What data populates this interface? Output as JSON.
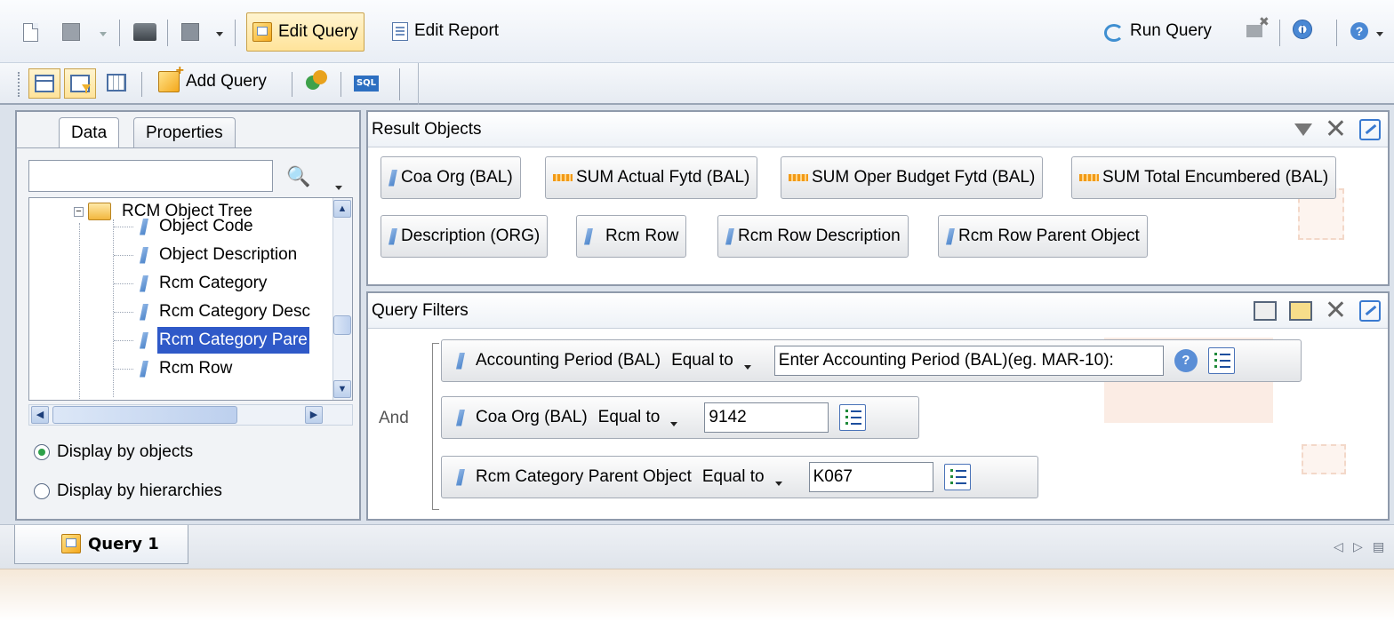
{
  "toolbar": {
    "edit_query_label": "Edit Query",
    "edit_report_label": "Edit Report",
    "run_query_label": "Run Query",
    "add_query_label": "Add Query",
    "sql_label": "SQL"
  },
  "left_panel": {
    "tabs": [
      "Data",
      "Properties"
    ],
    "search": {
      "value": "",
      "placeholder": ""
    },
    "tree": {
      "root": "RCM Object Tree",
      "items": [
        "Object Code",
        "Object Description",
        "Rcm Category",
        "Rcm Category Desc",
        "Rcm Category Pare",
        "Rcm Row"
      ],
      "selected": "Rcm Category Pare"
    },
    "display_options": [
      "Display by objects",
      "Display by hierarchies"
    ],
    "display_selected": "Display by objects"
  },
  "result_objects": {
    "title": "Result Objects",
    "items": [
      {
        "label": "Coa Org (BAL)",
        "kind": "dimension"
      },
      {
        "label": "SUM Actual Fytd (BAL)",
        "kind": "measure"
      },
      {
        "label": "SUM Oper Budget Fytd (BAL)",
        "kind": "measure"
      },
      {
        "label": "SUM Total Encumbered (BAL)",
        "kind": "measure"
      },
      {
        "label": "Description (ORG)",
        "kind": "dimension"
      },
      {
        "label": "Rcm Row",
        "kind": "dimension"
      },
      {
        "label": "Rcm Row Description",
        "kind": "dimension"
      },
      {
        "label": "Rcm Row Parent Object",
        "kind": "dimension"
      }
    ]
  },
  "query_filters": {
    "title": "Query Filters",
    "operator_group": "And",
    "filters": [
      {
        "object": "Accounting Period (BAL)",
        "operator": "Equal to",
        "value": "Enter Accounting Period (BAL)(eg. MAR-10):"
      },
      {
        "object": "Coa Org (BAL)",
        "operator": "Equal to",
        "value": "9142"
      },
      {
        "object": "Rcm Category Parent Object",
        "operator": "Equal to",
        "value": "K067"
      }
    ]
  },
  "query_tabs": [
    "Query 1"
  ],
  "icons": {
    "new": "new-document-icon",
    "save": "save-icon",
    "print": "print-icon",
    "refresh": "refresh-icon",
    "purge": "purge-icon",
    "info": "info-icon",
    "help": "help-icon",
    "binoculars": "binoculars-icon"
  },
  "colors": {
    "selection": "#2f59c8",
    "measure": "#f29a16",
    "dimension": "#3d7ac5",
    "radio_checked": "#2ea14a"
  }
}
